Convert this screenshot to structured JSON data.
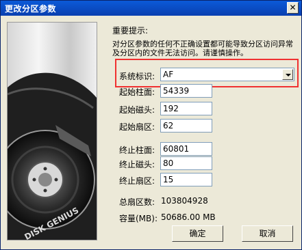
{
  "window": {
    "title": "更改分区参数",
    "close_glyph": "✕"
  },
  "hint": {
    "title": "重要提示:",
    "text": "对分区参数的任何不正确设置都可能导致分区访问异常及分区内的文件无法访问。请谨慎操作。"
  },
  "branding": {
    "art_text": "DISK GENIUS"
  },
  "fields": {
    "system_id": {
      "label": "系统标识:",
      "value": "AF"
    },
    "start_cylinder": {
      "label": "起始柱面:",
      "value": "54339"
    },
    "start_head": {
      "label": "起始磁头:",
      "value": "192"
    },
    "start_sector": {
      "label": "起始扇区:",
      "value": "62"
    },
    "end_cylinder": {
      "label": "终止柱面:",
      "value": "60801"
    },
    "end_head": {
      "label": "终止磁头:",
      "value": "80"
    },
    "end_sector": {
      "label": "终止扇区:",
      "value": "15"
    }
  },
  "summary": {
    "total_sectors_label": "总扇区数:",
    "total_sectors_value": "103804928",
    "capacity_label": "容量(MB):",
    "capacity_value": "50686.00 MB"
  },
  "buttons": {
    "ok": "确定",
    "cancel": "取消"
  },
  "colors": {
    "title_bar": "#0a3fb0",
    "highlight_border": "#f03030",
    "dialog_bg": "#ece9d8"
  }
}
